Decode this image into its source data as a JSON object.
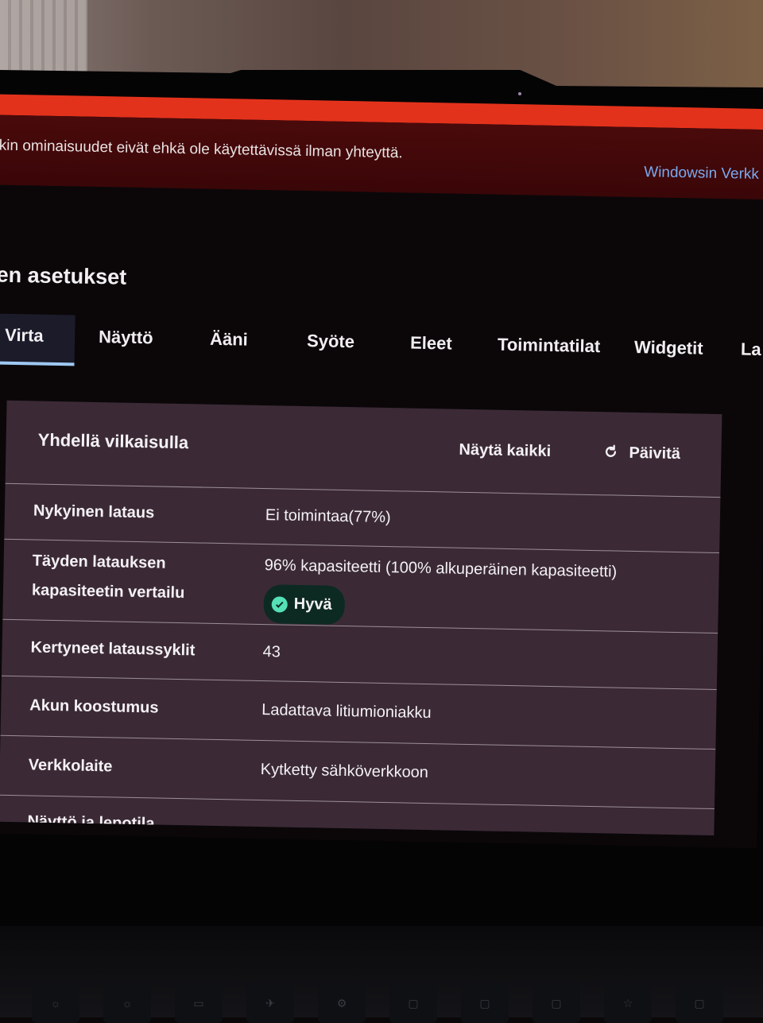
{
  "banner": {
    "message": "kin ominaisuudet eivät ehkä ole käytettävissä ilman yhteyttä.",
    "link": "Windowsin Verkk"
  },
  "page_title": "en asetukset",
  "tabs": [
    {
      "label": "Virta",
      "active": true
    },
    {
      "label": "Näyttö"
    },
    {
      "label": "Ääni"
    },
    {
      "label": "Syöte"
    },
    {
      "label": "Eleet"
    },
    {
      "label": "Toimintatilat"
    },
    {
      "label": "Widgetit"
    },
    {
      "label": "La"
    }
  ],
  "card": {
    "title": "Yhdellä vilkaisulla",
    "show_all": "Näytä kaikki",
    "refresh": "Päivitä",
    "rows": [
      {
        "label": "Nykyinen lataus",
        "value": "Ei toimintaa(77%)"
      },
      {
        "label_line1": "Täyden latauksen",
        "label_line2": "kapasiteetin vertailu",
        "value": "96% kapasiteetti (100% alkuperäinen kapasiteetti)",
        "badge": "Hyvä"
      },
      {
        "label": "Kertyneet lataussyklit",
        "value": "43"
      },
      {
        "label": "Akun koostumus",
        "value": "Ladattava litiumioniakku"
      },
      {
        "label": "Verkkolaite",
        "value": "Kytketty sähköverkkoon"
      },
      {
        "label": "Näyttö ja lepotila"
      }
    ]
  },
  "colors": {
    "banner_accent": "#e3321b",
    "banner_bg": "#4a0a0b",
    "card_bg": "#3b2a36",
    "badge_bg": "#0d2a22",
    "badge_icon": "#55e0b5",
    "link": "#7aa9f0",
    "tab_underline": "#9ec8f2"
  },
  "icons": {
    "refresh": "refresh-icon",
    "badge": "check-circle-icon"
  }
}
